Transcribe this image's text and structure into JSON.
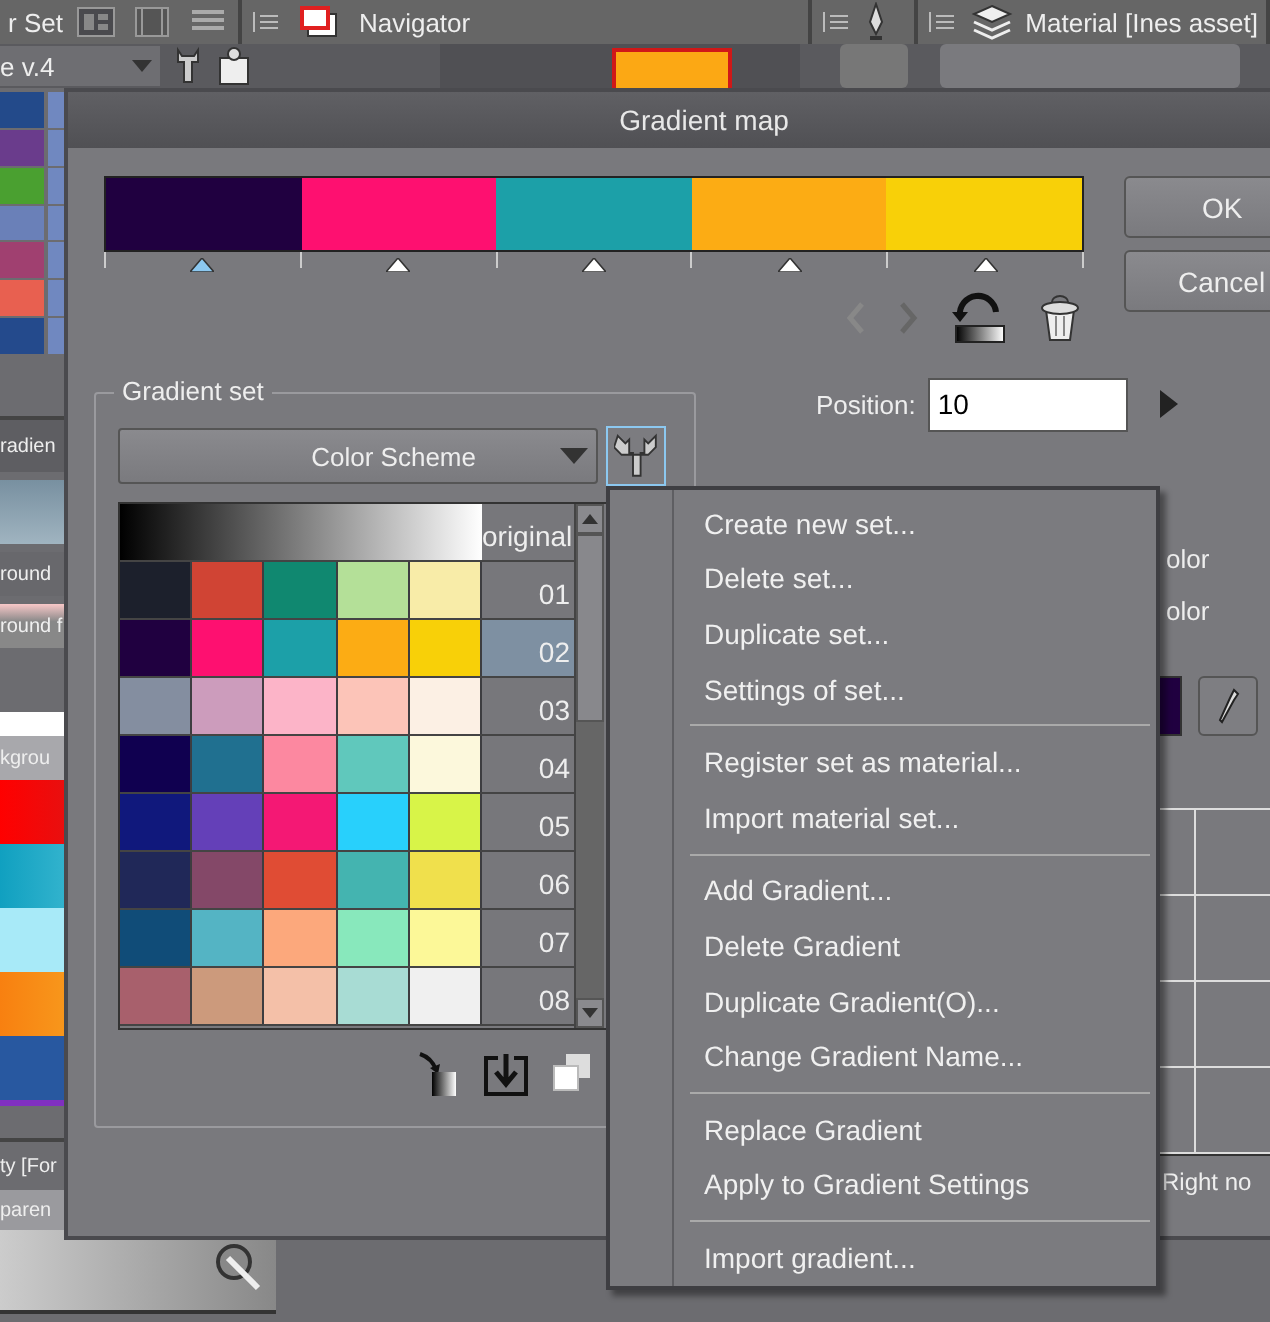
{
  "app": {
    "top_tabs": [
      {
        "label": "r Set"
      },
      {
        "label": "Navigator"
      },
      {
        "label": "Material [Ines asset]"
      }
    ],
    "brush_select": "e v.4",
    "left_panel": {
      "header": "radien",
      "layers": [
        {
          "label": "round",
          "kind": "plain"
        },
        {
          "label": "round f",
          "kind": "pink"
        }
      ],
      "material_label": "kgrou",
      "footer_labels": [
        "ty [For",
        "paren"
      ]
    }
  },
  "dialog": {
    "title": "Gradient map",
    "gradient": {
      "stops": [
        {
          "color": "#200040",
          "selected": true
        },
        {
          "color": "#fe1070",
          "selected": false
        },
        {
          "color": "#1ca0a8",
          "selected": false
        },
        {
          "color": "#fcac14",
          "selected": false
        },
        {
          "color": "#f8d008",
          "selected": false
        }
      ]
    },
    "buttons": [
      "OK",
      "Cancel"
    ],
    "position": {
      "label": "Position:",
      "value": "10"
    },
    "gradient_set": {
      "title": "Gradient set",
      "dropdown": "Color Scheme",
      "rows": [
        {
          "label": "original",
          "kind": "grayscale",
          "selected": false
        },
        {
          "label": "01",
          "kind": "colors",
          "swatches": [
            {
              "color": "#1c202c"
            },
            {
              "color": "#d04434"
            },
            {
              "color": "#108870"
            },
            {
              "color": "#b4e098"
            },
            {
              "color": "#f8eca8"
            }
          ],
          "selected": false
        },
        {
          "label": "02",
          "kind": "colors",
          "swatches": [
            {
              "color": "#200040"
            },
            {
              "color": "#fe1070"
            },
            {
              "color": "#1ca0a8"
            },
            {
              "color": "#fcac14"
            },
            {
              "color": "#f8d008"
            }
          ],
          "selected": true
        },
        {
          "label": "03",
          "kind": "colors",
          "swatches": [
            {
              "color": "#848ea0"
            },
            {
              "color": "#cc9cbc"
            },
            {
              "color": "#fcb4c8"
            },
            {
              "color": "#fcc4b8"
            },
            {
              "color": "#fcf0e4"
            }
          ],
          "selected": false
        },
        {
          "label": "04",
          "kind": "colors",
          "swatches": [
            {
              "color": "#100050"
            },
            {
              "color": "#207090"
            },
            {
              "color": "#fc88a0"
            },
            {
              "color": "#60c8bc"
            },
            {
              "color": "#fcf8dc"
            }
          ],
          "selected": false
        },
        {
          "label": "05",
          "kind": "colors",
          "swatches": [
            {
              "color": "#10187c"
            },
            {
              "color": "#6440b8"
            },
            {
              "color": "#f41874"
            },
            {
              "color": "#28d0fc"
            },
            {
              "color": "#d8f448"
            }
          ],
          "selected": false
        },
        {
          "label": "06",
          "kind": "colors",
          "swatches": [
            {
              "color": "#202858"
            },
            {
              "color": "#844868"
            },
            {
              "color": "#e04c34"
            },
            {
              "color": "#44b4b0"
            },
            {
              "color": "#f0e04c"
            }
          ],
          "selected": false
        },
        {
          "label": "07",
          "kind": "colors",
          "swatches": [
            {
              "color": "#104c78"
            },
            {
              "color": "#54b4c4"
            },
            {
              "color": "#fca87c"
            },
            {
              "color": "#88e8bc"
            },
            {
              "color": "#fcf898"
            }
          ],
          "selected": false
        },
        {
          "label": "08",
          "kind": "colors",
          "swatches": [
            {
              "color": "#a8606c"
            },
            {
              "color": "#cc9a7c"
            },
            {
              "color": "#f4c0a8"
            },
            {
              "color": "#a8dcd4"
            },
            {
              "color": "#f0f0f0"
            }
          ],
          "selected": false
        }
      ]
    },
    "side_options": {
      "labels": [
        "olor",
        "olor"
      ],
      "footer": "Right no"
    }
  },
  "menu": {
    "groups": [
      [
        "Create new set...",
        "Delete set...",
        "Duplicate set...",
        "Settings of set..."
      ],
      [
        "Register set as material...",
        "Import material set..."
      ],
      [
        "Add Gradient...",
        "Delete Gradient",
        "Duplicate Gradient(O)...",
        "Change Gradient Name..."
      ],
      [
        "Replace Gradient",
        "Apply to Gradient Settings"
      ],
      [
        "Import gradient..."
      ]
    ]
  }
}
